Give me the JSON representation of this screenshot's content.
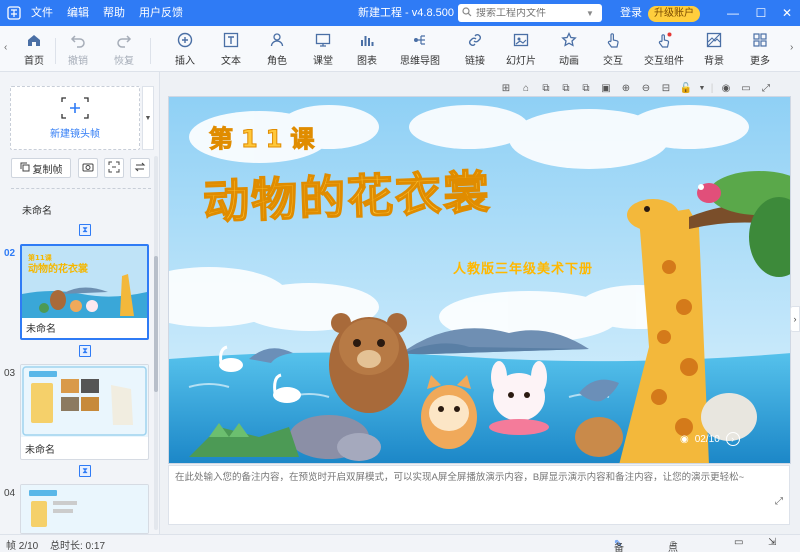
{
  "window": {
    "title": "新建工程 - v4.8.500",
    "menu": [
      "文件",
      "编辑",
      "帮助",
      "用户反馈"
    ],
    "search_placeholder": "搜索工程内文件",
    "login_label": "登录",
    "upgrade_label": "升级账户"
  },
  "toolbar": {
    "home": "首页",
    "undo": "撤销",
    "redo": "恢复",
    "insert": "插入",
    "text": "文本",
    "role": "角色",
    "classroom": "课堂",
    "chart": "图表",
    "mindmap": "思维导图",
    "link": "链接",
    "slides": "幻灯片",
    "animation": "动画",
    "interaction": "交互",
    "interaction_component": "交互组件",
    "background": "背景",
    "more": "更多"
  },
  "sidebar": {
    "new_frame_label": "新建镜头帧",
    "copy_frame_label": "复制帧",
    "top_frame_name": "未命名",
    "frames": [
      {
        "num": "02",
        "name": "未命名"
      },
      {
        "num": "03",
        "name": "未命名"
      },
      {
        "num": "04",
        "name": ""
      }
    ]
  },
  "slide": {
    "lesson": "第11课",
    "title": "动物的花衣裳",
    "subtitle": "人教版三年级美术下册",
    "pager": "02/10"
  },
  "notes": {
    "placeholder": "在此处输入您的备注内容，在预览时开启双屏模式，可以实现A屏全屏播放演示内容，B屏显示演示内容和备注内容，让您的演示更轻松~"
  },
  "status": {
    "frame": "帧 2/10",
    "duration": "总时长: 0:17",
    "notes_label": "备注",
    "rollcall_label": "点名"
  },
  "colors": {
    "accent": "#2f7bf5",
    "titlebar": "#2f7bf5",
    "upgrade": "#ffce3d",
    "slide_title": "#ffc83a"
  }
}
